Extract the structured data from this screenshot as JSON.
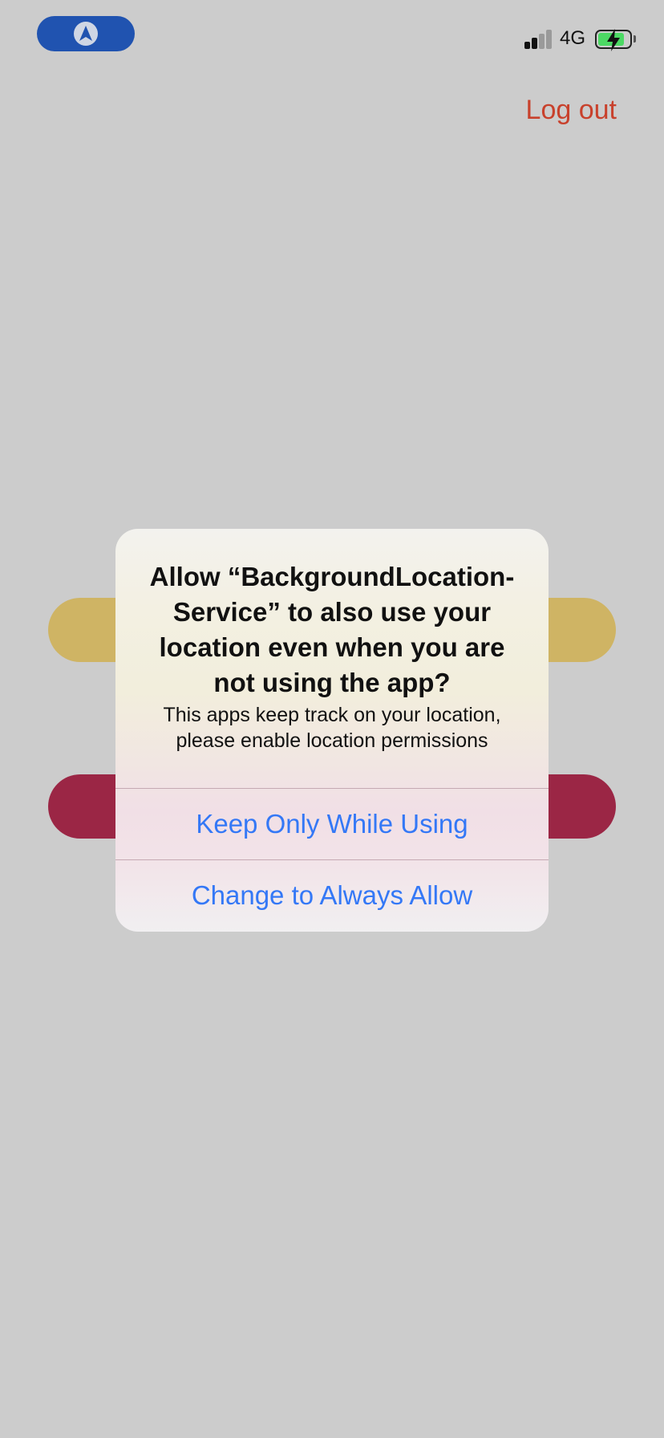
{
  "status_bar": {
    "network": "4G",
    "signal_bars_active": 2,
    "signal_bars_total": 4,
    "battery_level_fraction": 0.75,
    "battery_charging": true,
    "location_indicator_icon": "location-arrow-icon"
  },
  "header": {
    "logout_label": "Log out"
  },
  "background_buttons": [
    {
      "color": "#cfb464"
    },
    {
      "color": "#9b2645"
    }
  ],
  "alert": {
    "title": "Allow “BackgroundLocation-Service” to also use your location even when you are not using the app?",
    "message": "This apps keep track on your location, please enable location permissions",
    "actions": [
      {
        "label": "Keep Only While Using"
      },
      {
        "label": "Change to Always Allow"
      }
    ]
  },
  "colors": {
    "background": "#cccccc",
    "accent_blue": "#3478f6",
    "logout_red": "#c8412c",
    "location_pill_blue": "#2053b0",
    "battery_green": "#4cd964"
  }
}
